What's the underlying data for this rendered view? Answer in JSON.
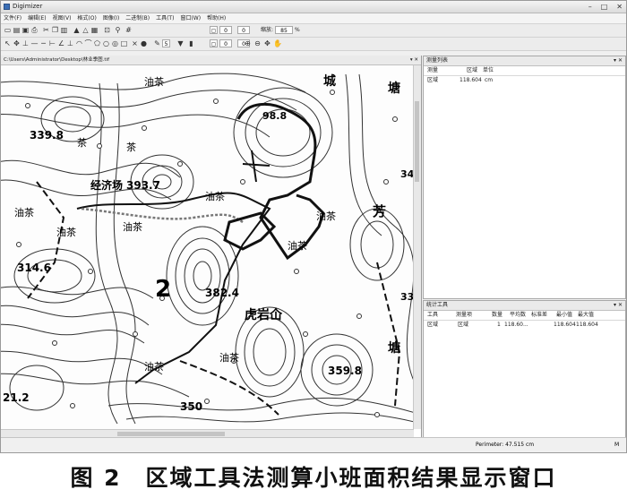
{
  "window": {
    "title": "Digimizer",
    "min": "–",
    "max": "□",
    "close": "✕"
  },
  "menu": [
    "文件(F)",
    "编辑(E)",
    "视图(V)",
    "格式(O)",
    "图像(I)",
    "二进制(B)",
    "工具(T)",
    "窗口(W)",
    "帮助(H)"
  ],
  "toolbar": {
    "field1": "0",
    "field2": "0",
    "zoom_label": "缩放:",
    "zoom_value": "85",
    "zoom_unit": "%",
    "field3": "0",
    "field4": "0",
    "field5": "5"
  },
  "map_window": {
    "path": "C:\\Users\\Administrator\\Desktop\\林业季图.tif",
    "labels": {
      "l1": "339.8",
      "l2": "油茶",
      "l3": "城",
      "l4": "塘",
      "l5": "98.8",
      "l6": "茶",
      "l7": "经济场",
      "l8": "393.7",
      "l9": "油茶",
      "l10": "油茶",
      "l11": "油茶",
      "l12": "油茶",
      "l13": "芳",
      "l14": "34",
      "l15": "油茶",
      "l16": "314.6",
      "l17": "382.4",
      "l18": "2",
      "l19": "虎岩仚",
      "l20": "33",
      "l21": "油茶",
      "l22": "塘",
      "l23": "359.8",
      "l24": "21.2",
      "l25": "350",
      "l26": "油茶",
      "l27": "茶",
      "l28": "油茶"
    }
  },
  "measurement_list": {
    "title": "测量列表",
    "columns": [
      "测量",
      "区域",
      "单位"
    ],
    "rows": [
      {
        "name": "区域",
        "value": "118.604",
        "unit": "cm"
      }
    ]
  },
  "statistics": {
    "title": "统计工具",
    "columns": [
      "工具",
      "测量项",
      "数量",
      "平均数",
      "标准差",
      "最小值",
      "最大值"
    ],
    "rows": [
      {
        "tool": "区域",
        "item": "区域",
        "count": "1",
        "mean": "118.60...",
        "sd": "",
        "min": "118.604",
        "max": "118.604"
      }
    ]
  },
  "status": {
    "perimeter": "Perimeter: 47.515 cm",
    "mode": "M"
  },
  "caption": "图 2　区域工具法测算小班面积结果显示窗口"
}
